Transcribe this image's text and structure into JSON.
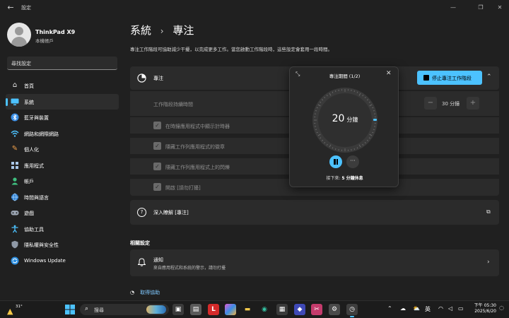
{
  "window": {
    "title": "設定",
    "controls": [
      "minimize",
      "maximize",
      "close"
    ]
  },
  "profile": {
    "name": "ThinkPad X9",
    "account": "本機帳戶"
  },
  "search": {
    "placeholder": "尋找設定"
  },
  "nav": [
    {
      "label": "首頁",
      "icon": "home-icon",
      "active": false
    },
    {
      "label": "系統",
      "icon": "system-icon",
      "active": true
    },
    {
      "label": "藍牙與裝置",
      "icon": "bluetooth-icon",
      "active": false
    },
    {
      "label": "網路和網際網路",
      "icon": "wifi-icon",
      "active": false
    },
    {
      "label": "個人化",
      "icon": "brush-icon",
      "active": false
    },
    {
      "label": "應用程式",
      "icon": "apps-icon",
      "active": false
    },
    {
      "label": "帳戶",
      "icon": "person-icon",
      "active": false
    },
    {
      "label": "時間與語言",
      "icon": "globe-icon",
      "active": false
    },
    {
      "label": "遊戲",
      "icon": "gamepad-icon",
      "active": false
    },
    {
      "label": "協助工具",
      "icon": "accessibility-icon",
      "active": false
    },
    {
      "label": "隱私權與安全性",
      "icon": "shield-icon",
      "active": false
    },
    {
      "label": "Windows Update",
      "icon": "update-icon",
      "active": false
    }
  ],
  "main": {
    "breadcrumb": [
      "系統",
      "專注"
    ],
    "breadcrumb_sep": "›",
    "description": "專注工作階段可協助減少干擾，以完成更多工作。當您啟動工作階段時，這些設定會套用一段時間。",
    "focus": {
      "label": "專注",
      "stop_button": "停止專注工作階段"
    },
    "duration": {
      "label": "工作階段持續時間",
      "value": "30 分鐘"
    },
    "options": [
      {
        "label": "在時鐘應用程式中顯示計時器",
        "checked": true
      },
      {
        "label": "隱藏工作列應用程式的徽章",
        "checked": true
      },
      {
        "label": "隱藏工作列應用程式上的閃爍",
        "checked": true
      },
      {
        "label": "開啟 [請勿打擾]",
        "checked": true
      }
    ],
    "learn_more": "深入瞭解 [專注]",
    "related_title": "相關設定",
    "notifications": {
      "title": "通知",
      "subtitle": "來自應用程式和系統的警示，請勿打擾"
    },
    "get_help": "取得協助"
  },
  "focus_timer": {
    "title": "專注期間 (1/2)",
    "minutes": "20",
    "unit": "分鐘",
    "progress": 0.333,
    "next_prefix": "接下來:",
    "next_value": "5 分鐘休息",
    "accent": "#4cc2ff"
  },
  "taskbar": {
    "weather_temp": "31°",
    "search_label": "搜尋",
    "ime": "英",
    "time": "下午 05:30",
    "date": "2025/6/20"
  },
  "colors": {
    "background": "#202020",
    "card": "#2b2b2b",
    "accent": "#4cc2ff"
  }
}
